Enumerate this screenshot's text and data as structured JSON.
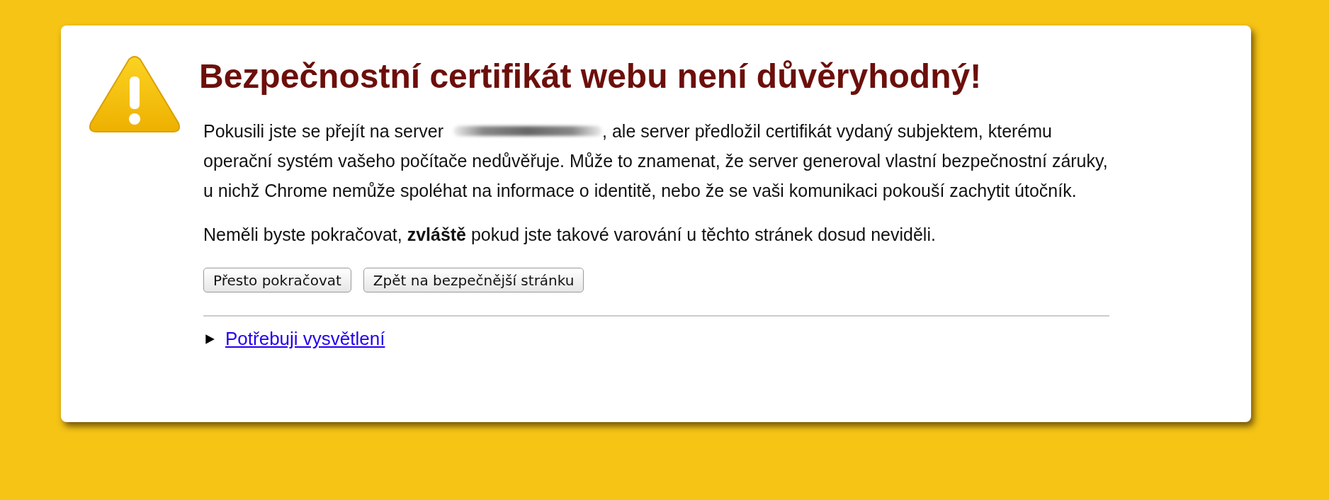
{
  "title": "Bezpečnostní certifikát webu není důvěryhodný!",
  "intro": {
    "before": "Pokusili jste se přejít na server",
    "after": ", ale server předložil certifikát vydaný subjektem, kterému",
    "continuation": "operační systém vašeho počítače nedůvěřuje. Může to znamenat, že server generoval vlastní bezpečnostní záruky, u nichž Chrome nemůže spoléhat na informace o identitě, nebo že se vaši komunikaci pokouší zachytit útočník."
  },
  "warning": "Neměli byste pokračovat, **zvláště** pokud jste takové varování u těchto stránek dosud neviděli.",
  "buttons": [
    {
      "label": "Přesto pokračovat"
    },
    {
      "label": "Zpět na bezpečnější stránku"
    }
  ],
  "details": {
    "label": "Potřebuji vysvětlení",
    "expanded": false
  }
}
